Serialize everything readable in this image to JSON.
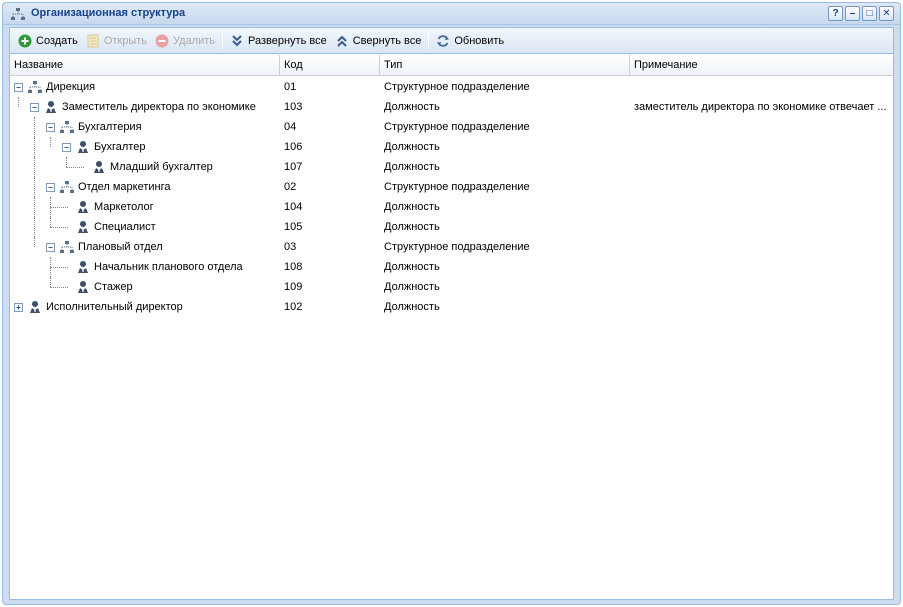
{
  "window": {
    "title": "Организационная структура",
    "controls": {
      "help": "?",
      "minimize": "–",
      "maximize": "□",
      "close": "✕"
    }
  },
  "toolbar": {
    "create": "Создать",
    "open": "Открыть",
    "delete": "Удалить",
    "expand_all": "Развернуть все",
    "collapse_all": "Свернуть все",
    "refresh": "Обновить"
  },
  "columns": {
    "name": "Название",
    "code": "Код",
    "type": "Тип",
    "note": "Примечание"
  },
  "rows": [
    {
      "name": "Дирекция",
      "code": "01",
      "type": "Структурное подразделение",
      "note": "",
      "depth": 0,
      "kind": "unit",
      "toggle": "-"
    },
    {
      "name": "Заместитель директора по экономике",
      "code": "103",
      "type": "Должность",
      "note": "заместитель директора по экономике отвечает ...",
      "depth": 1,
      "kind": "position",
      "toggle": "-"
    },
    {
      "name": "Бухгалтерия",
      "code": "04",
      "type": "Структурное подразделение",
      "note": "",
      "depth": 2,
      "kind": "unit",
      "toggle": "-"
    },
    {
      "name": "Бухгалтер",
      "code": "106",
      "type": "Должность",
      "note": "",
      "depth": 3,
      "kind": "position",
      "toggle": "-"
    },
    {
      "name": "Младший бухгалтер",
      "code": "107",
      "type": "Должность",
      "note": "",
      "depth": 4,
      "kind": "position",
      "toggle": ""
    },
    {
      "name": "Отдел маркетинга",
      "code": "02",
      "type": "Структурное подразделение",
      "note": "",
      "depth": 2,
      "kind": "unit",
      "toggle": "-"
    },
    {
      "name": "Маркетолог",
      "code": "104",
      "type": "Должность",
      "note": "",
      "depth": 3,
      "kind": "position",
      "toggle": ""
    },
    {
      "name": "Специалист",
      "code": "105",
      "type": "Должность",
      "note": "",
      "depth": 3,
      "kind": "position",
      "toggle": ""
    },
    {
      "name": "Плановый отдел",
      "code": "03",
      "type": "Структурное подразделение",
      "note": "",
      "depth": 2,
      "kind": "unit",
      "toggle": "-"
    },
    {
      "name": "Начальник планового отдела",
      "code": "108",
      "type": "Должность",
      "note": "",
      "depth": 3,
      "kind": "position",
      "toggle": ""
    },
    {
      "name": "Стажер",
      "code": "109",
      "type": "Должность",
      "note": "",
      "depth": 3,
      "kind": "position",
      "toggle": ""
    },
    {
      "name": "Исполнительный директор",
      "code": "102",
      "type": "Должность",
      "note": "",
      "depth": 0,
      "kind": "position",
      "toggle": "+"
    }
  ],
  "colors": {
    "title": "#15428b",
    "create_icon": "#2e9a3c",
    "delete_icon": "#e07a7a",
    "accent_blue": "#3a6fb5"
  }
}
